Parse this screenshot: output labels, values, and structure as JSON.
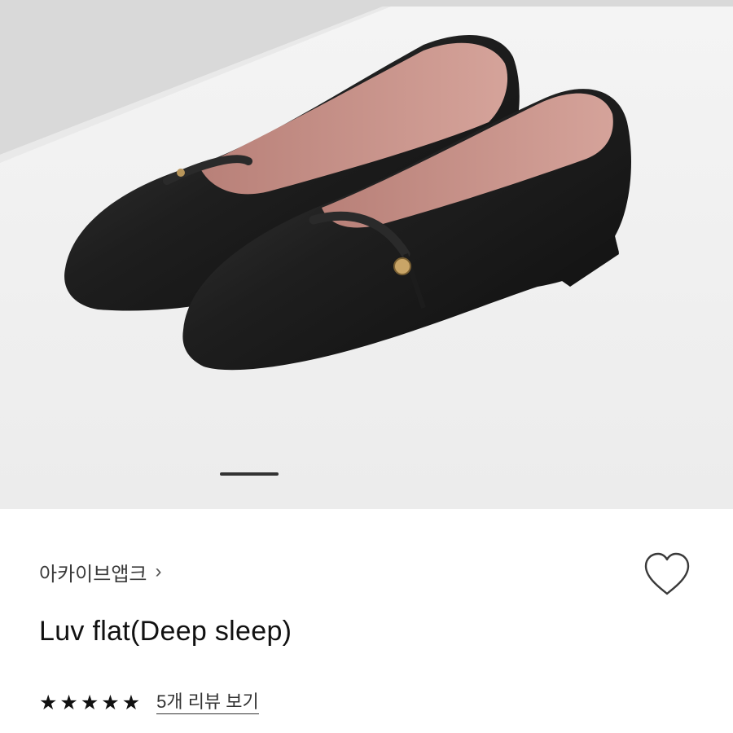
{
  "gallery": {
    "image_alt": "black leather mary jane flats",
    "indicator": {
      "active_index": 0,
      "active_color": "#333333"
    }
  },
  "product": {
    "brand": "아카이브앱크",
    "brand_chevron": "›",
    "name": "Luv flat(Deep sleep)",
    "wishlist_icon": "heart-outline-icon",
    "rating": {
      "stars": 5,
      "max": 5,
      "star_glyph": "★"
    },
    "review_link": "5개 리뷰 보기"
  }
}
